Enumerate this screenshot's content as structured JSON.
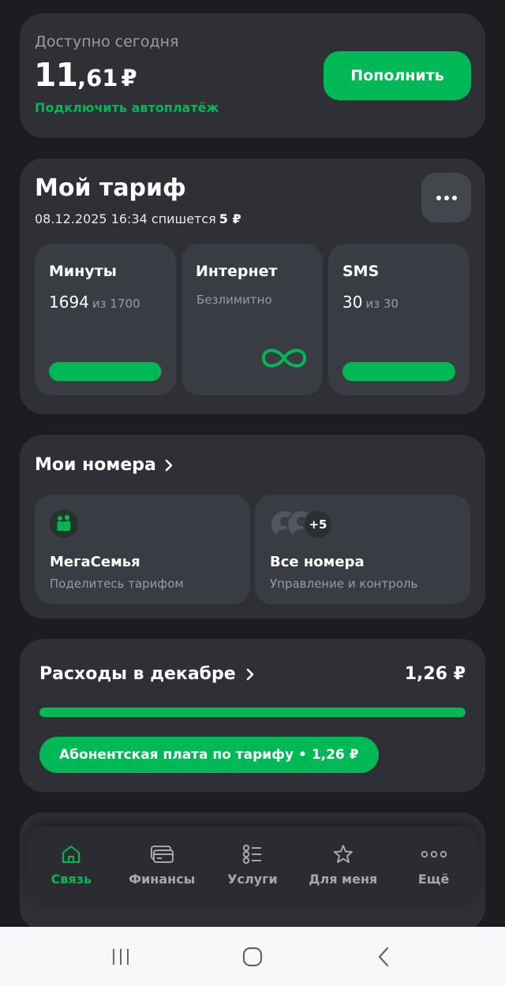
{
  "balance": {
    "label": "Доступно сегодня",
    "amount_int": "11",
    "amount_frac": ",61",
    "currency": "₽",
    "autopay_link": "Подключить автоплатёж",
    "topup_button": "Пополнить"
  },
  "tariff": {
    "title": "Мой тариф",
    "charge_text": "08.12.2025 16:34 спишется",
    "charge_amount": "5 ₽",
    "packages": [
      {
        "title": "Минуты",
        "value": "1694",
        "of": "из 1700",
        "fraction": 0.996
      },
      {
        "title": "Интернет",
        "note": "Безлимитно"
      },
      {
        "title": "SMS",
        "value": "30",
        "of": "из 30",
        "fraction": 1.0
      }
    ]
  },
  "numbers": {
    "title": "Мои номера",
    "family": {
      "title": "МегаСемья",
      "subtitle": "Поделитесь тарифом"
    },
    "all": {
      "title": "Все номера",
      "subtitle": "Управление и контроль",
      "extra_count": "+5"
    }
  },
  "expenses": {
    "title": "Расходы в декабре",
    "total": "1,26 ₽",
    "fraction": 1.0,
    "item_pill": "Абонентская плата по тарифу • 1,26 ₽"
  },
  "nav": {
    "items": [
      {
        "label": "Связь",
        "icon": "home-icon",
        "active": true
      },
      {
        "label": "Финансы",
        "icon": "wallet-icon",
        "active": false
      },
      {
        "label": "Услуги",
        "icon": "list-icon",
        "active": false
      },
      {
        "label": "Для меня",
        "icon": "star-icon",
        "active": false
      },
      {
        "label": "Ещё",
        "icon": "more-icon",
        "active": false
      }
    ]
  },
  "colors": {
    "accent": "#00b956",
    "background": "#1c1d21",
    "card": "#2e3036",
    "inner_card": "#3a3c43"
  }
}
